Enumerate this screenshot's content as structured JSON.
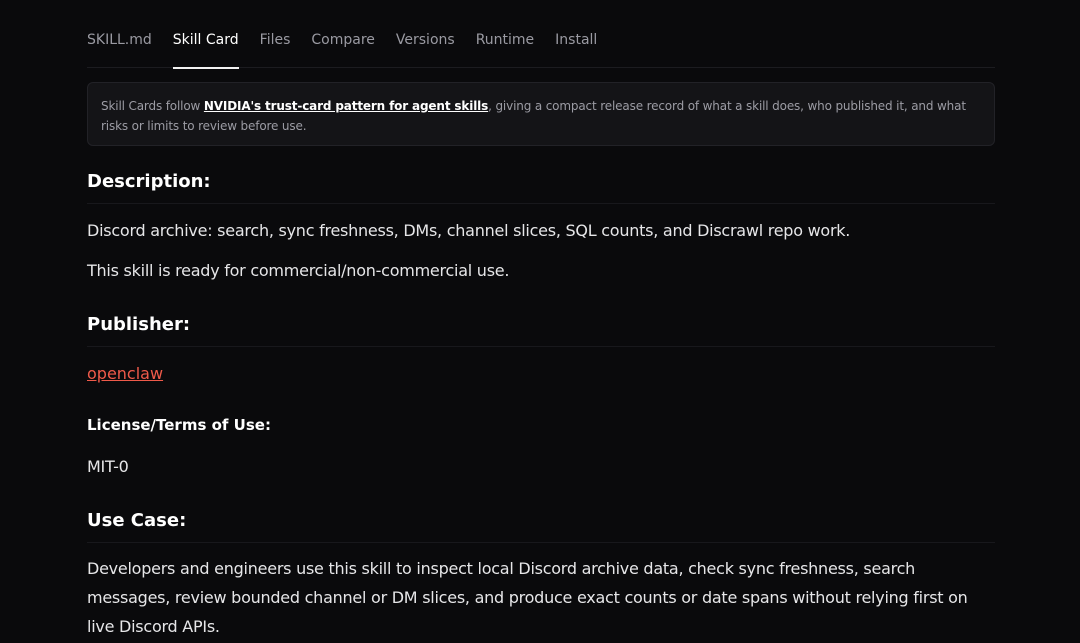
{
  "tabs": [
    {
      "label": "SKILL.md"
    },
    {
      "label": "Skill Card"
    },
    {
      "label": "Files"
    },
    {
      "label": "Compare"
    },
    {
      "label": "Versions"
    },
    {
      "label": "Runtime"
    },
    {
      "label": "Install"
    }
  ],
  "active_tab": "Skill Card",
  "notice": {
    "prefix": "Skill Cards follow ",
    "link_text": "NVIDIA's trust-card pattern for agent skills",
    "suffix": ", giving a compact release record of what a skill does, who published it, and what risks or limits to review before use."
  },
  "description": {
    "heading": "Description:",
    "line1": "Discord archive: search, sync freshness, DMs, channel slices, SQL counts, and Discrawl repo work.",
    "line2": "This skill is ready for commercial/non-commercial use."
  },
  "publisher": {
    "heading": "Publisher:",
    "name": "openclaw"
  },
  "license": {
    "heading": "License/Terms of Use:",
    "value": "MIT-0"
  },
  "use_case": {
    "heading": "Use Case:",
    "text": "Developers and engineers use this skill to inspect local Discord archive data, check sync freshness, search messages, review bounded channel or DM slices, and produce exact counts or date spans without relying first on live Discord APIs."
  },
  "colors": {
    "background": "#0a0a0c",
    "link_accent": "#ef5a4a"
  }
}
